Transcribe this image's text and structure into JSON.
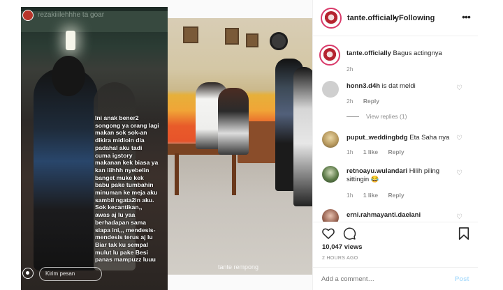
{
  "colors": {
    "text": "#262626",
    "muted": "#8e8e8e",
    "border": "#efefef",
    "post_button_disabled": "#b2dffc",
    "avatar_ring": "#d93a6a"
  },
  "media": {
    "left_panel": {
      "header_text": "rezakiiilehhhe ta goar",
      "caption": "Ini anak bener2\nsongong ya orang lagi\nmakan sok sok-an\ndikira midioin dia\npadahal aku tadi\ncuma igstory\nmakanan kek biasa ya\nkan iiihhh nyebelin\nbanget muke kek\nbabu pake tumbahin\nminuman ke meja aku\nsambil ngata2in aku.\nSok kecantikan,,\nawas aj lu yaa\nberhadapan sama\nsiapa ini,,, mendesis-\nmendesis terus aj lu\nBiar tak ku sempal\nmulut lu pake Besi\npanas mampuzz luuu",
      "message_placeholder": "Kirim pesan"
    },
    "right_panel": {
      "watermark": "tante rempong"
    }
  },
  "post": {
    "header": {
      "username": "tante.officially",
      "separator": "•",
      "follow_status": "Following",
      "more_icon": "more-horizontal-icon"
    },
    "comments": [
      {
        "username": "tante.officially",
        "text": "Bagus actingnya",
        "time": "2h",
        "likes": "",
        "reply": "",
        "avatar_color": "#b5232f"
      },
      {
        "username": "honn3.d4h",
        "text": "is dat meldi",
        "time": "2h",
        "likes": "",
        "reply": "Reply",
        "view_replies": "View replies (1)",
        "avatar_color": "#c9c9c9"
      },
      {
        "username": "puput_weddingbdg",
        "text": "Eta Saha nya",
        "time": "1h",
        "likes": "1 like",
        "reply": "Reply",
        "avatar_color": "#b8a27a"
      },
      {
        "username": "retnoayu.wulandari",
        "text": "Hilih piling sittingin 😂",
        "time": "1h",
        "likes": "1 like",
        "reply": "Reply",
        "avatar_color": "#3b5d3a"
      },
      {
        "username": "erni.rahmayanti.daelani",
        "text": "",
        "time": "",
        "likes": "",
        "reply": "",
        "avatar_color": "#8b5b4a"
      }
    ],
    "actions": {
      "like_icon": "heart-icon",
      "comment_icon": "comment-icon",
      "save_icon": "bookmark-icon"
    },
    "views": "10,047 views",
    "posted_ago": "2 HOURS AGO",
    "add_comment_placeholder": "Add a comment…",
    "post_label": "Post"
  }
}
